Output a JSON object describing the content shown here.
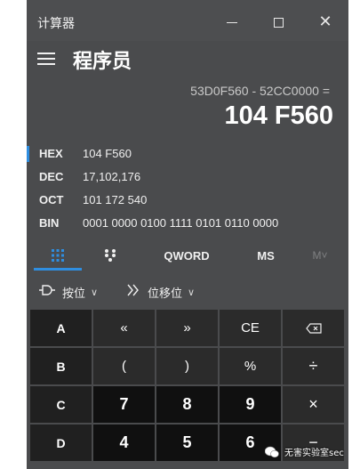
{
  "window": {
    "title": "计算器"
  },
  "header": {
    "mode": "程序员"
  },
  "display": {
    "expression": "53D0F560 - 52CC0000 =",
    "result": "104 F560"
  },
  "radix": [
    {
      "label": "HEX",
      "value": "104 F560",
      "selected": true
    },
    {
      "label": "DEC",
      "value": "17,102,176",
      "selected": false
    },
    {
      "label": "OCT",
      "value": "101 172 540",
      "selected": false
    },
    {
      "label": "BIN",
      "value": "0001 0000 0100 1111 0101 0110 0000",
      "selected": false
    }
  ],
  "tabs": {
    "keypad_icon": "keypad-grid-icon",
    "bit_icon": "bit-toggle-icon",
    "word": "QWORD",
    "ms": "MS",
    "mstar": "M˅"
  },
  "ops": {
    "bitwise": "按位",
    "bitshift": "位移位"
  },
  "keys": [
    [
      "A",
      "«",
      "»",
      "CE",
      "⌫"
    ],
    [
      "B",
      "(",
      ")",
      "%",
      "÷"
    ],
    [
      "C",
      "7",
      "8",
      "9",
      "×"
    ],
    [
      "D",
      "4",
      "5",
      "6",
      "−"
    ]
  ],
  "watermark": "无害实验室sec",
  "colors": {
    "accent": "#2f8ee0",
    "bg": "#4a4b4d",
    "key_dark": "#101010",
    "key_fn": "#2b2b2b"
  }
}
